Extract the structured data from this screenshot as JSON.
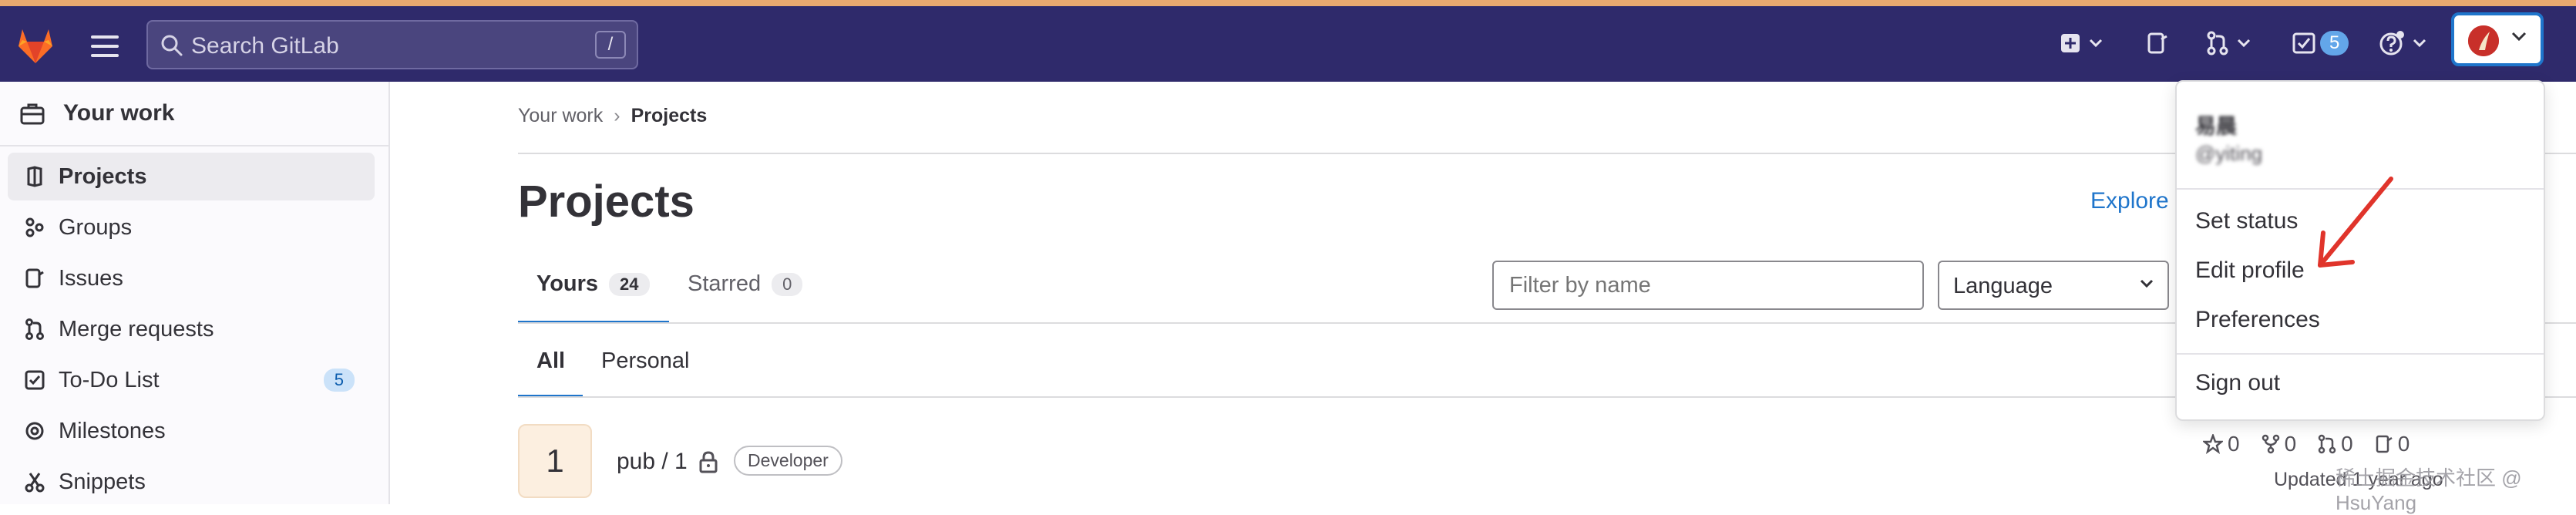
{
  "topbar": {
    "search_placeholder": "Search GitLab",
    "search_shortcut": "/",
    "todo_count": "5"
  },
  "user_menu": {
    "display_name": "易晨",
    "username": "@yiting",
    "items": [
      "Set status",
      "Edit profile",
      "Preferences",
      "Sign out"
    ]
  },
  "sidebar": {
    "header": "Your work",
    "items": [
      {
        "label": "Projects",
        "icon": "project-icon",
        "active": true
      },
      {
        "label": "Groups",
        "icon": "group-icon"
      },
      {
        "label": "Issues",
        "icon": "issues-icon"
      },
      {
        "label": "Merge requests",
        "icon": "merge-request-icon"
      },
      {
        "label": "To-Do List",
        "icon": "todo-icon",
        "count": "5"
      },
      {
        "label": "Milestones",
        "icon": "milestone-icon"
      },
      {
        "label": "Snippets",
        "icon": "snippet-icon"
      }
    ]
  },
  "breadcrumb": {
    "parent": "Your work",
    "current": "Projects"
  },
  "page": {
    "title": "Projects",
    "explore_link": "Explore",
    "tabs": [
      {
        "label": "Yours",
        "count": "24",
        "active": true
      },
      {
        "label": "Starred",
        "count": "0"
      }
    ],
    "filter_placeholder": "Filter by name",
    "language_select": "Language",
    "subtabs": [
      {
        "label": "All",
        "active": true
      },
      {
        "label": "Personal"
      }
    ]
  },
  "projects": [
    {
      "avatar_letter": "1",
      "name": "pub / 1",
      "role": "Developer",
      "stars": "0",
      "forks": "0",
      "merge_requests": "0",
      "issues": "0",
      "updated": "Updated 1 year ago"
    }
  ],
  "watermark": "稀土掘金技术社区 @ HsuYang",
  "colors": {
    "navbar": "#2f2a6b",
    "accent": "#1f75cb",
    "annotation_arrow": "#e0342b"
  }
}
